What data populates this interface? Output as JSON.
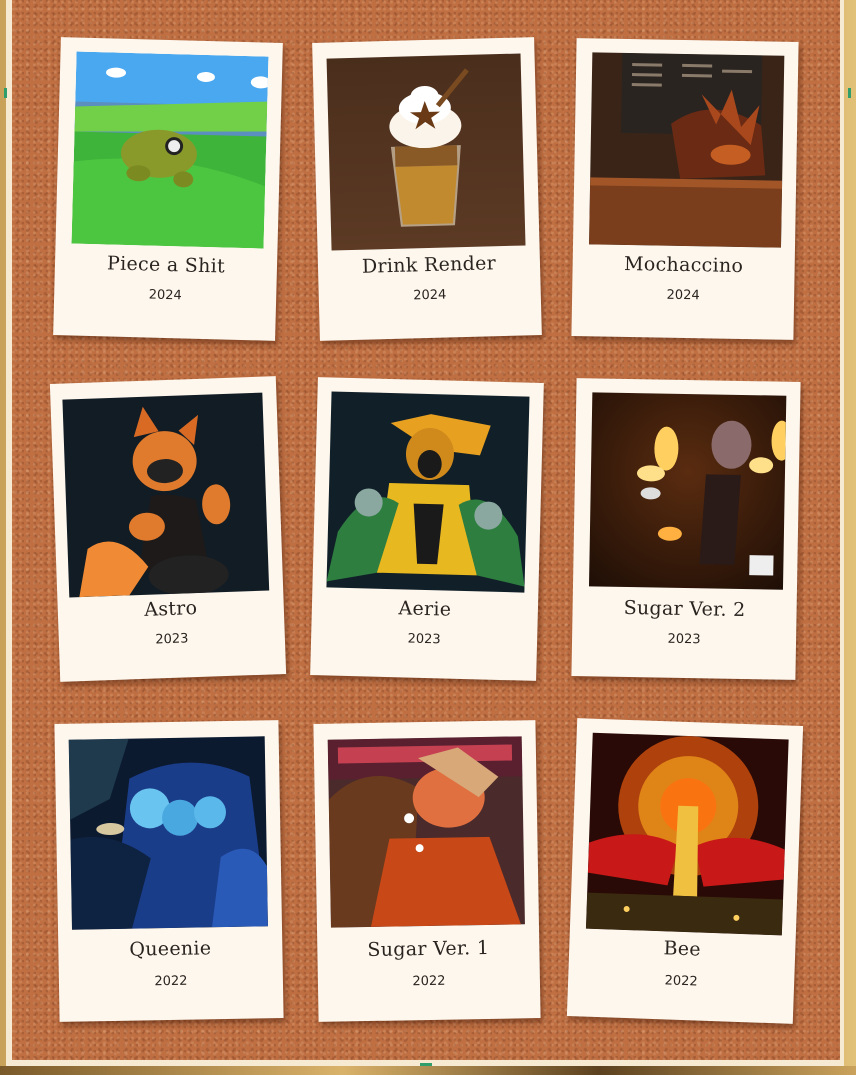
{
  "polaroids": [
    {
      "title": "Piece a Shit",
      "year": "2024"
    },
    {
      "title": "Drink Render",
      "year": "2024"
    },
    {
      "title": "Mochaccino",
      "year": "2024"
    },
    {
      "title": "Astro",
      "year": "2023"
    },
    {
      "title": "Aerie",
      "year": "2023"
    },
    {
      "title": "Sugar Ver. 2",
      "year": "2023"
    },
    {
      "title": "Queenie",
      "year": "2022"
    },
    {
      "title": "Sugar Ver. 1",
      "year": "2022"
    },
    {
      "title": "Bee",
      "year": "2022"
    }
  ],
  "colors": {
    "cork": "#bf6f42",
    "polaroid_paper": "#fdf7ee",
    "caption_text": "#2a2420",
    "frame_gold": "#c9a25a"
  }
}
